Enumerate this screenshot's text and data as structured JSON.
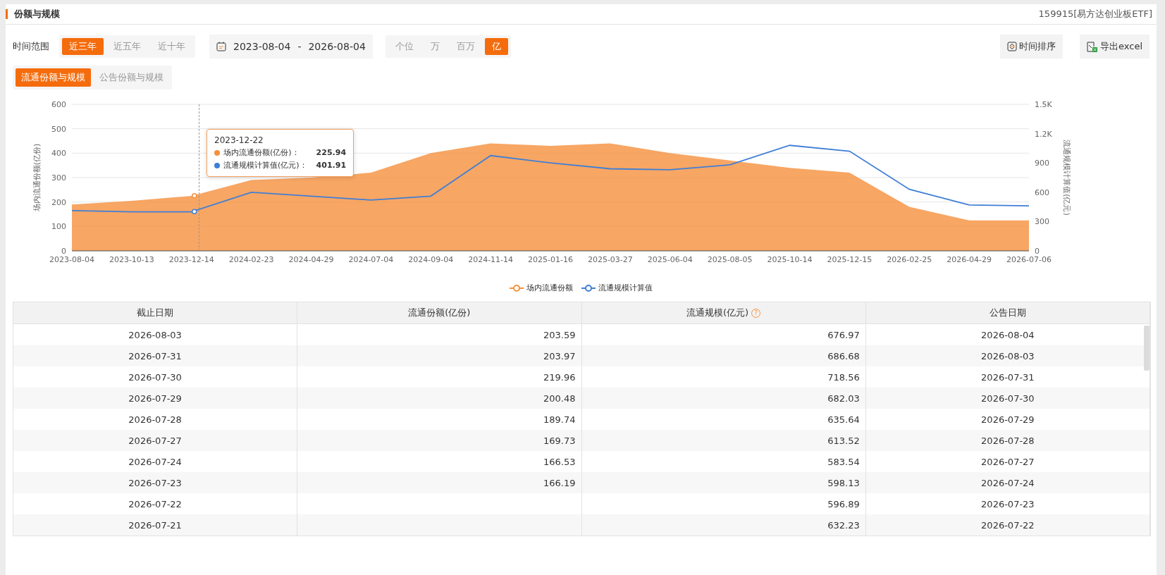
{
  "header": {
    "title": "份额与规模",
    "fund": "159915[易方达创业板ETF]"
  },
  "range": {
    "label": "时间范围",
    "options": [
      {
        "label": "近三年",
        "selected": true
      },
      {
        "label": "近五年",
        "selected": false
      },
      {
        "label": "近十年",
        "selected": false
      }
    ]
  },
  "date_range": {
    "start": "2023-08-04",
    "separator": "-",
    "end": "2026-08-04"
  },
  "units": [
    {
      "label": "个位",
      "selected": false
    },
    {
      "label": "万",
      "selected": false
    },
    {
      "label": "百万",
      "selected": false
    },
    {
      "label": "亿",
      "selected": true
    }
  ],
  "actions": [
    {
      "kind": "sort",
      "label": "时间排序"
    },
    {
      "kind": "excel",
      "label": "导出excel"
    }
  ],
  "tabs": [
    {
      "label": "流通份额与规模",
      "selected": true
    },
    {
      "label": "公告份额与规模",
      "selected": false
    }
  ],
  "chart_data": {
    "type": "area",
    "ylabel": "场内流通份额(亿份)",
    "y2label": "流通规模计算值(亿元)",
    "categories": [
      "2023-08-04",
      "2023-10-13",
      "2023-12-14",
      "2024-02-23",
      "2024-04-29",
      "2024-07-04",
      "2024-09-04",
      "2024-11-14",
      "2025-01-16",
      "2025-03-27",
      "2025-06-04",
      "2025-08-05",
      "2025-10-14",
      "2025-12-15",
      "2026-02-25",
      "2026-04-29",
      "2026-07-06"
    ],
    "series": [
      {
        "name": "场内流通份额",
        "color": "#f5903d",
        "values": [
          190,
          205,
          225,
          290,
          300,
          320,
          400,
          440,
          430,
          440,
          400,
          370,
          340,
          320,
          180,
          125,
          125
        ]
      },
      {
        "name": "流通规模计算值",
        "color": "#3f7fd6",
        "type": "line",
        "axis": "y2",
        "values": [
          412,
          400,
          400,
          600,
          560,
          520,
          560,
          975,
          900,
          840,
          830,
          880,
          1080,
          1020,
          630,
          470,
          460
        ]
      }
    ],
    "grid": true,
    "ylim": [
      0,
      600
    ],
    "yticks": [
      0,
      100,
      200,
      300,
      400,
      500,
      600
    ],
    "y2lim": [
      0,
      1500
    ],
    "y2ticks": [
      {
        "value": 0,
        "label": "0"
      },
      {
        "value": 300,
        "label": "300"
      },
      {
        "value": 600,
        "label": "600"
      },
      {
        "value": 900,
        "label": "900"
      },
      {
        "value": 1200,
        "label": "1.2K"
      },
      {
        "value": 1500,
        "label": "1.5K"
      }
    ]
  },
  "tooltip": {
    "date": "2023-12-22",
    "rows": [
      {
        "label": "场内流通份额(亿份)：",
        "value": "225.94",
        "color": "#f5903d"
      },
      {
        "label": "流通规模计算值(亿元)：",
        "value": "401.91",
        "color": "#3f7fd6"
      }
    ]
  },
  "table": {
    "columns": [
      {
        "label": "截止日期"
      },
      {
        "label": "流通份额(亿份)"
      },
      {
        "label": "流通规模(亿元)",
        "help": "?"
      },
      {
        "label": "公告日期"
      }
    ],
    "rows": [
      [
        "2026-08-03",
        "203.59",
        "676.97",
        "2026-08-04"
      ],
      [
        "2026-07-31",
        "203.97",
        "686.68",
        "2026-08-03"
      ],
      [
        "2026-07-30",
        "219.96",
        "718.56",
        "2026-07-31"
      ],
      [
        "2026-07-29",
        "200.48",
        "682.03",
        "2026-07-30"
      ],
      [
        "2026-07-28",
        "189.74",
        "635.64",
        "2026-07-29"
      ],
      [
        "2026-07-27",
        "169.73",
        "613.52",
        "2026-07-28"
      ],
      [
        "2026-07-24",
        "166.53",
        "583.54",
        "2026-07-27"
      ],
      [
        "2026-07-23",
        "166.19",
        "598.13",
        "2026-07-24"
      ],
      [
        "2026-07-22",
        null,
        "596.89",
        "2026-07-23"
      ],
      [
        "2026-07-21",
        null,
        "632.23",
        "2026-07-22"
      ]
    ]
  }
}
